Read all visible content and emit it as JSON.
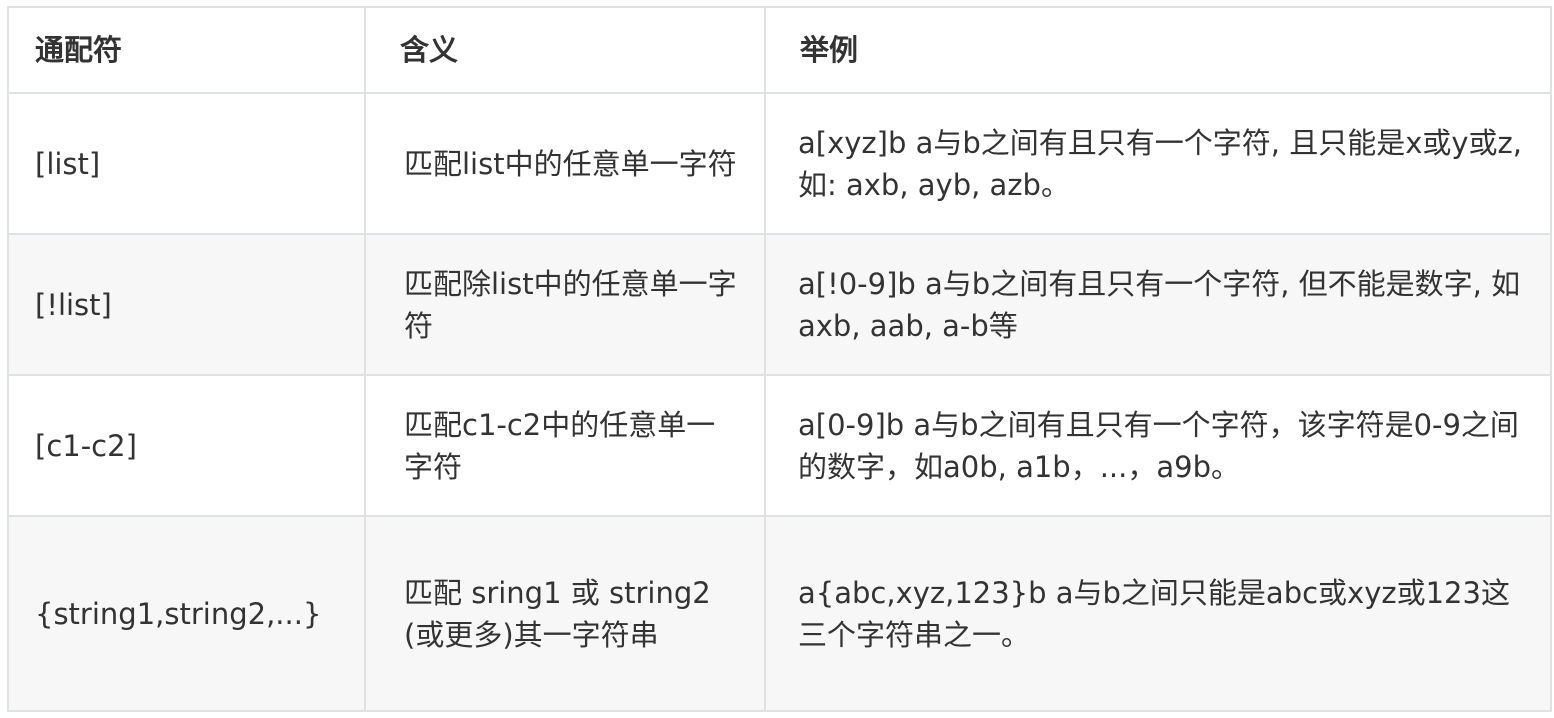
{
  "table": {
    "headers": [
      "通配符",
      "含义",
      "举例"
    ],
    "rows": [
      {
        "wildcard": "[list]",
        "meaning": "匹配list中的任意单一字符",
        "example": "a[xyz]b  a与b之间有且只有一个字符, 且只能是x或y或z, 如: axb, ayb, azb。"
      },
      {
        "wildcard": "[!list]",
        "meaning": "匹配除list中的任意单一字符",
        "example": "a[!0-9]b  a与b之间有且只有一个字符, 但不能是数字, 如axb, aab, a-b等"
      },
      {
        "wildcard": "[c1-c2]",
        "meaning": "匹配c1-c2中的任意单一字符",
        "example": "a[0-9]b  a与b之间有且只有一个字符，该字符是0-9之间的数字，如a0b, a1b，...，a9b。"
      },
      {
        "wildcard": "{string1,string2,...}",
        "meaning": "匹配 sring1 或 string2 (或更多)其一字符串",
        "example": "a{abc,xyz,123}b    a与b之间只能是abc或xyz或123这三个字符串之一。"
      }
    ]
  },
  "colors": {
    "border": "#dfe2e5",
    "alt_row": "#f7f7f7",
    "text": "#333333"
  }
}
